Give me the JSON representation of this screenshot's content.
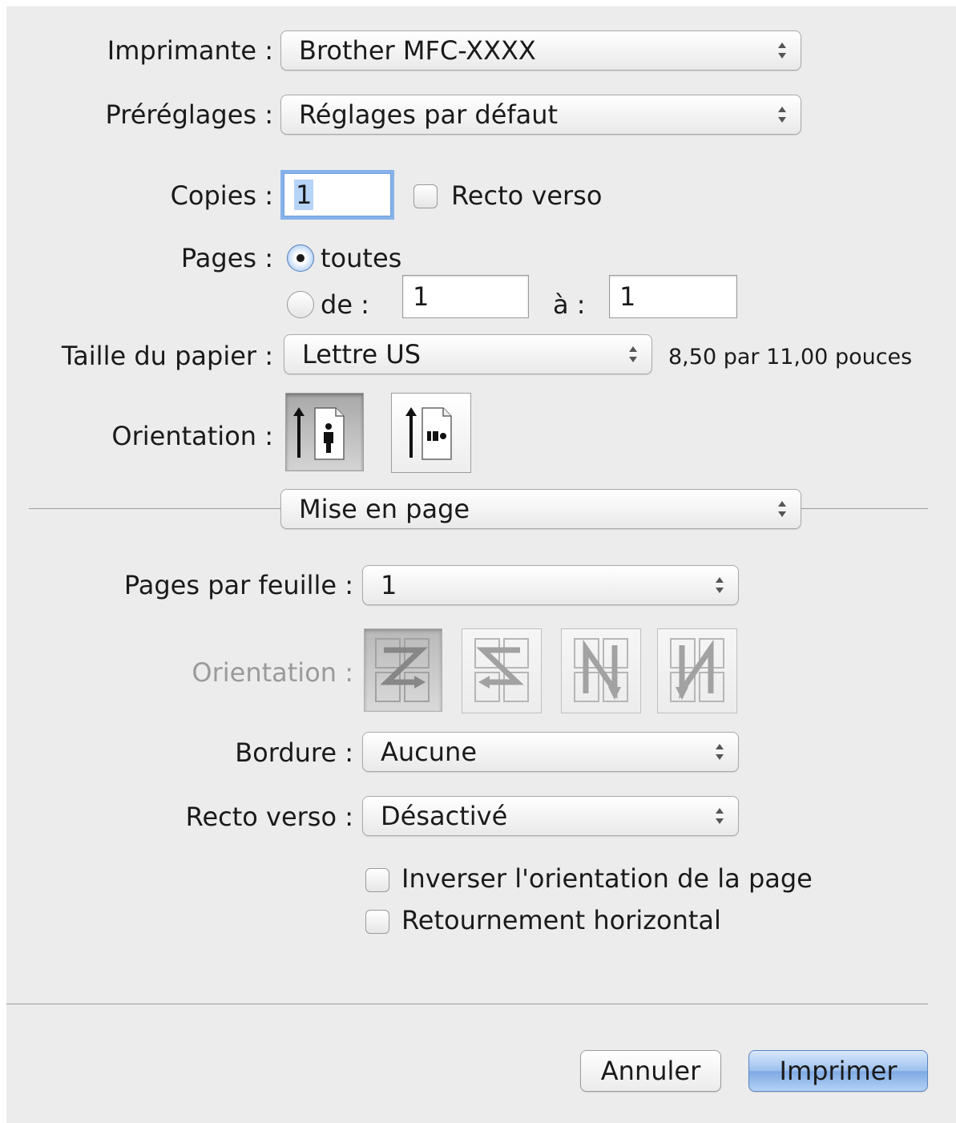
{
  "printer": {
    "label": "Imprimante :",
    "value": "Brother MFC-XXXX"
  },
  "presets": {
    "label": "Préréglages :",
    "value": "Réglages par défaut"
  },
  "copies": {
    "label": "Copies :",
    "value": "1",
    "duplex_label": "Recto verso",
    "duplex_checked": false
  },
  "pages": {
    "label": "Pages :",
    "all_label": "toutes",
    "range_label": "de :",
    "from_value": "1",
    "to_label": "à :",
    "to_value": "1",
    "selected": "toutes"
  },
  "paper": {
    "label": "Taille du papier :",
    "value": "Lettre US",
    "dimensions": "8,50 par 11,00 pouces"
  },
  "orientation": {
    "label": "Orientation :",
    "options": [
      "portrait-icon",
      "landscape-icon"
    ],
    "selected": "portrait-icon"
  },
  "section_popup": {
    "value": "Mise en page"
  },
  "layout": {
    "pages_per_sheet": {
      "label": "Pages par feuille :",
      "value": "1"
    },
    "direction": {
      "label": "Orientation :",
      "options": [
        "z-layout-icon",
        "reverse-z-layout-icon",
        "n-layout-icon",
        "reverse-n-layout-icon"
      ],
      "selected": "z-layout-icon",
      "enabled": false
    },
    "border": {
      "label": "Bordure :",
      "value": "Aucune"
    },
    "two_sided": {
      "label": "Recto verso :",
      "value": "Désactivé"
    },
    "reverse_orientation": {
      "label": "Inverser l'orientation de la page",
      "checked": false
    },
    "flip_horizontal": {
      "label": "Retournement horizontal",
      "checked": false
    }
  },
  "footer": {
    "cancel_label": "Annuler",
    "print_label": "Imprimer"
  },
  "colors": {
    "background": "#ececec",
    "focus_ring": "#86b2ea",
    "primary_button": "#9dc1ee"
  }
}
